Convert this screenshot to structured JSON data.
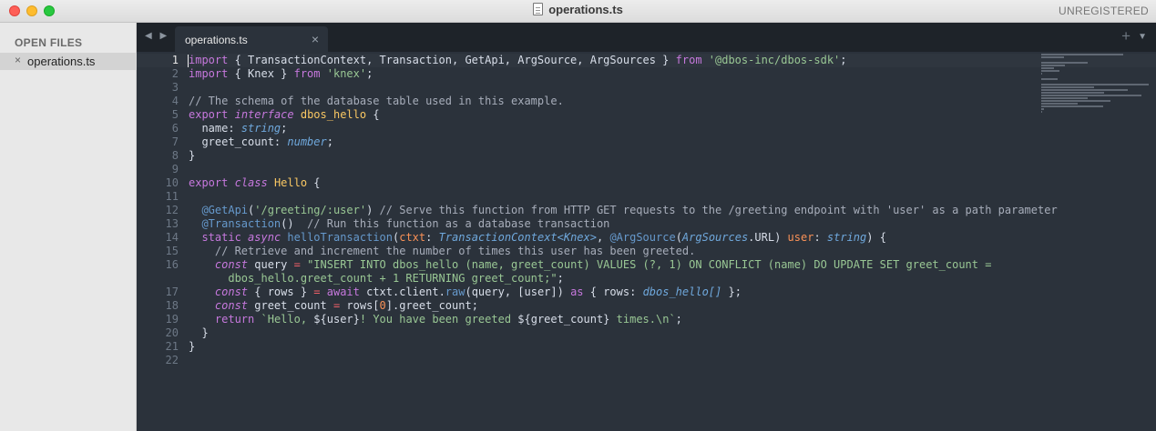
{
  "window": {
    "title": "operations.ts",
    "registration": "UNREGISTERED"
  },
  "sidebar": {
    "header": "OPEN FILES",
    "files": [
      {
        "name": "operations.ts",
        "close": "×"
      }
    ]
  },
  "tabs": {
    "nav": "◀ ▶",
    "active": {
      "label": "operations.ts",
      "close": "×"
    },
    "plus": "+",
    "menu": "▼"
  },
  "editor": {
    "active_line": 1,
    "lines": [
      [
        [
          "kw",
          "import"
        ],
        [
          "op",
          " { TransactionContext, Transaction, GetApi, ArgSource, ArgSources } "
        ],
        [
          "kw",
          "from"
        ],
        [
          "op",
          " "
        ],
        [
          "str",
          "'@dbos-inc/dbos-sdk'"
        ],
        [
          "op",
          ";"
        ]
      ],
      [
        [
          "kw",
          "import"
        ],
        [
          "op",
          " { Knex } "
        ],
        [
          "kw",
          "from"
        ],
        [
          "op",
          " "
        ],
        [
          "str",
          "'knex'"
        ],
        [
          "op",
          ";"
        ]
      ],
      [],
      [
        [
          "com",
          "// The schema of the database table used in this example."
        ]
      ],
      [
        [
          "kw",
          "export"
        ],
        [
          "op",
          " "
        ],
        [
          "kwi",
          "interface"
        ],
        [
          "op",
          " "
        ],
        [
          "cls",
          "dbos_hello"
        ],
        [
          "op",
          " {"
        ]
      ],
      [
        [
          "op",
          "  name: "
        ],
        [
          "ty",
          "string"
        ],
        [
          "op",
          ";"
        ]
      ],
      [
        [
          "op",
          "  greet_count: "
        ],
        [
          "ty",
          "number"
        ],
        [
          "op",
          ";"
        ]
      ],
      [
        [
          "op",
          "}"
        ]
      ],
      [],
      [
        [
          "kw",
          "export"
        ],
        [
          "op",
          " "
        ],
        [
          "kwi",
          "class"
        ],
        [
          "op",
          " "
        ],
        [
          "cls",
          "Hello"
        ],
        [
          "op",
          " {"
        ]
      ],
      [],
      [
        [
          "op",
          "  "
        ],
        [
          "dec",
          "@GetApi"
        ],
        [
          "op",
          "("
        ],
        [
          "str",
          "'/greeting/:user'"
        ],
        [
          "op",
          ") "
        ],
        [
          "com",
          "// Serve this function from HTTP GET requests to the /greeting endpoint with 'user' as a path parameter"
        ]
      ],
      [
        [
          "op",
          "  "
        ],
        [
          "dec",
          "@Transaction"
        ],
        [
          "op",
          "()  "
        ],
        [
          "com",
          "// Run this function as a database transaction"
        ]
      ],
      [
        [
          "op",
          "  "
        ],
        [
          "kw",
          "static"
        ],
        [
          "op",
          " "
        ],
        [
          "kwi",
          "async"
        ],
        [
          "op",
          " "
        ],
        [
          "fn",
          "helloTransaction"
        ],
        [
          "op",
          "("
        ],
        [
          "prm",
          "ctxt"
        ],
        [
          "op",
          ": "
        ],
        [
          "ty",
          "TransactionContext<Knex>"
        ],
        [
          "op",
          ", "
        ],
        [
          "dec",
          "@ArgSource"
        ],
        [
          "op",
          "("
        ],
        [
          "ty",
          "ArgSources"
        ],
        [
          "op",
          ".URL) "
        ],
        [
          "prm",
          "user"
        ],
        [
          "op",
          ": "
        ],
        [
          "ty",
          "string"
        ],
        [
          "op",
          ") {"
        ]
      ],
      [
        [
          "op",
          "    "
        ],
        [
          "com",
          "// Retrieve and increment the number of times this user has been greeted."
        ]
      ],
      [
        [
          "op",
          "    "
        ],
        [
          "kwi",
          "const"
        ],
        [
          "op",
          " query "
        ],
        [
          "red",
          "="
        ],
        [
          "op",
          " "
        ],
        [
          "str",
          "\"INSERT INTO dbos_hello (name, greet_count) VALUES (?, 1) ON CONFLICT (name) DO UPDATE SET greet_count ="
        ]
      ],
      [
        [
          "str",
          "      dbos_hello.greet_count + 1 RETURNING greet_count;\""
        ],
        [
          "op",
          ";"
        ]
      ],
      [
        [
          "op",
          "    "
        ],
        [
          "kwi",
          "const"
        ],
        [
          "op",
          " { rows } "
        ],
        [
          "red",
          "="
        ],
        [
          "op",
          " "
        ],
        [
          "kw",
          "await"
        ],
        [
          "op",
          " ctxt.client."
        ],
        [
          "fn",
          "raw"
        ],
        [
          "op",
          "(query, [user]) "
        ],
        [
          "kw",
          "as"
        ],
        [
          "op",
          " { rows: "
        ],
        [
          "ty",
          "dbos_hello[]"
        ],
        [
          "op",
          " };"
        ]
      ],
      [
        [
          "op",
          "    "
        ],
        [
          "kwi",
          "const"
        ],
        [
          "op",
          " greet_count "
        ],
        [
          "red",
          "="
        ],
        [
          "op",
          " rows["
        ],
        [
          "num",
          "0"
        ],
        [
          "op",
          "].greet_count;"
        ]
      ],
      [
        [
          "op",
          "    "
        ],
        [
          "kw",
          "return"
        ],
        [
          "op",
          " "
        ],
        [
          "str",
          "`Hello, "
        ],
        [
          "op",
          "${user}"
        ],
        [
          "str",
          "! You have been greeted "
        ],
        [
          "op",
          "${greet_count}"
        ],
        [
          "str",
          " times.\\n`"
        ],
        [
          "op",
          ";"
        ]
      ],
      [
        [
          "op",
          "  }"
        ]
      ],
      [
        [
          "op",
          "}"
        ]
      ],
      []
    ],
    "line_numbers": [
      "1",
      "2",
      "3",
      "4",
      "5",
      "6",
      "7",
      "8",
      "9",
      "10",
      "11",
      "12",
      "13",
      "14",
      "15",
      "16",
      "",
      "17",
      "18",
      "19",
      "20",
      "21",
      "22"
    ]
  },
  "colors": {
    "editor_bg": "#2b323b",
    "tabbar_bg": "#1e2329",
    "sidebar_bg": "#e8e8e8"
  }
}
